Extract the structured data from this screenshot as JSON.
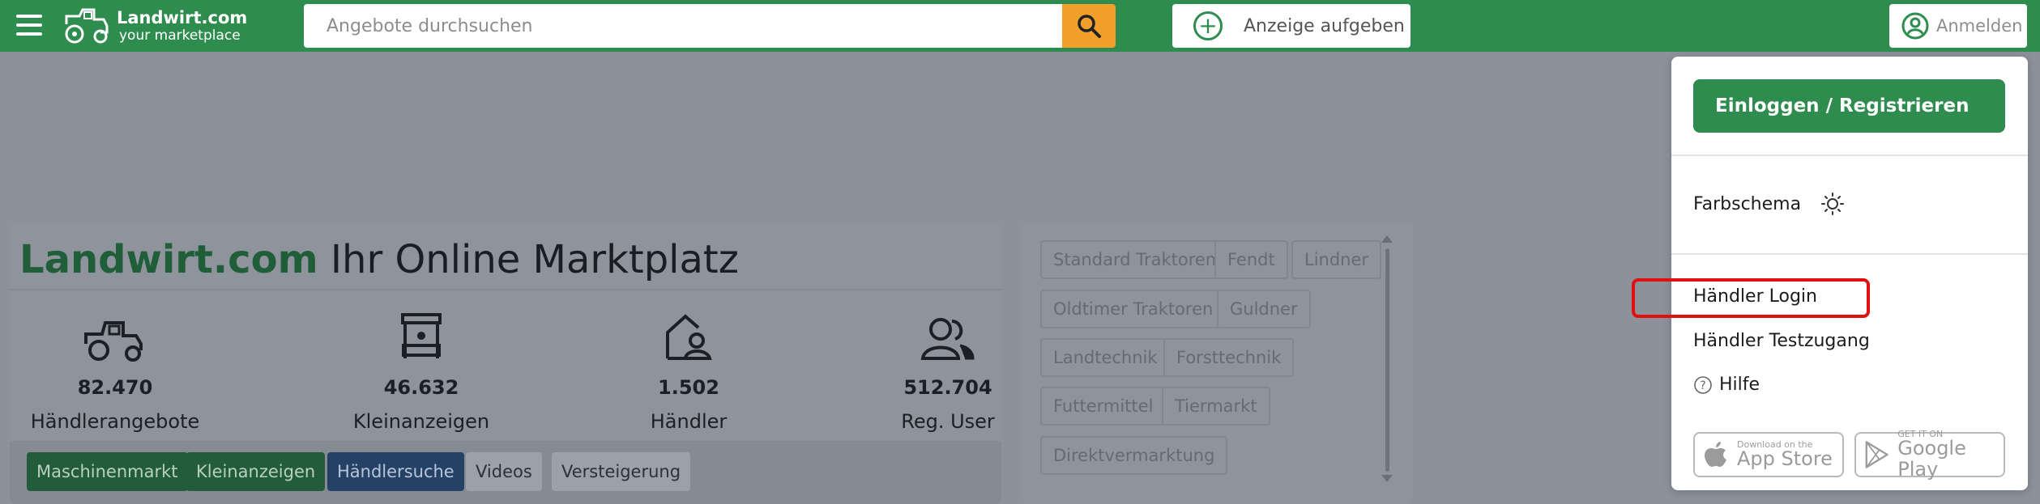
{
  "header": {
    "logo_title": "Landwirt.com",
    "logo_subtitle": "your marketplace",
    "search_placeholder": "Angebote durchsuchen",
    "post_ad_label": "Anzeige aufgeben",
    "signin_label": "Anmelden"
  },
  "hero": {
    "brand": "Landwirt.com",
    "title_rest": " Ihr Online Marktplatz",
    "stats": [
      {
        "icon": "tractor-icon",
        "value": "82.470",
        "label": "Händlerangebote"
      },
      {
        "icon": "market-stall-icon",
        "value": "46.632",
        "label": "Kleinanzeigen"
      },
      {
        "icon": "dealer-house-icon",
        "value": "1.502",
        "label": "Händler"
      },
      {
        "icon": "users-icon",
        "value": "512.704",
        "label": "Reg. User"
      }
    ],
    "tabs": [
      "Maschinenmarkt",
      "Kleinanzeigen",
      "Händlersuche",
      "Videos",
      "Versteigerung"
    ]
  },
  "categories": [
    "Standard Traktoren",
    "Fendt",
    "Lindner",
    "Oldtimer Traktoren",
    "Guldner",
    "Landtechnik",
    "Forsttechnik",
    "Futtermittel",
    "Tiermarkt",
    "Direktvermarktung"
  ],
  "dropdown": {
    "login_button": "Einloggen / Registrieren",
    "color_scheme": "Farbschema",
    "dealer_login": "Händler Login",
    "dealer_trial": "Händler Testzugang",
    "help": "Hilfe",
    "app_store_small": "Download on the",
    "app_store_big": "App Store",
    "google_small": "GET IT ON",
    "google_big": "Google Play"
  },
  "colors": {
    "brand_green": "#2f8c4f",
    "search_button": "#f0a02b",
    "highlight": "#e01010"
  }
}
